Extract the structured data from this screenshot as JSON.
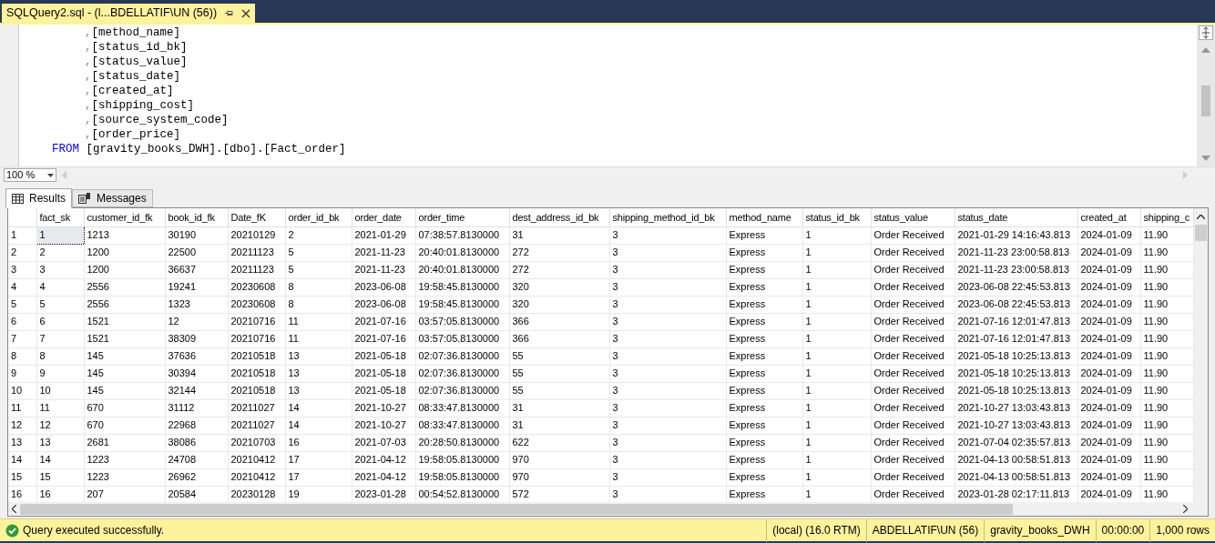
{
  "document_tab": {
    "title": "SQLQuery2.sql - (l...BDELLATIF\\UN (56))"
  },
  "editor": {
    "lines": [
      {
        "kind": "column",
        "prefix": ",",
        "text": "[method_name]"
      },
      {
        "kind": "column",
        "prefix": ",",
        "text": "[status_id_bk]"
      },
      {
        "kind": "column",
        "prefix": ",",
        "text": "[status_value]"
      },
      {
        "kind": "column",
        "prefix": ",",
        "text": "[status_date]"
      },
      {
        "kind": "column",
        "prefix": ",",
        "text": "[created_at]"
      },
      {
        "kind": "column",
        "prefix": ",",
        "text": "[shipping_cost]"
      },
      {
        "kind": "column",
        "prefix": ",",
        "text": "[source_system_code]"
      },
      {
        "kind": "column",
        "prefix": ",",
        "text": "[order_price]"
      },
      {
        "kind": "from",
        "keyword": "FROM",
        "text": "[gravity_books_DWH].[dbo].[Fact_order]"
      }
    ]
  },
  "zoom": {
    "value": "100 %"
  },
  "result_tabs": [
    {
      "label": "Results",
      "selected": true
    },
    {
      "label": "Messages",
      "selected": false
    }
  ],
  "table": {
    "columns": [
      "fact_sk",
      "customer_id_fk",
      "book_id_fk",
      "Date_fK",
      "order_id_bk",
      "order_date",
      "order_time",
      "dest_address_id_bk",
      "shipping_method_id_bk",
      "method_name",
      "status_id_bk",
      "status_value",
      "status_date",
      "created_at",
      "shipping_c"
    ],
    "rows": [
      {
        "number": "1",
        "focused": true,
        "cells": [
          "1",
          "1213",
          "30190",
          "20210129",
          "2",
          "2021-01-29",
          "07:38:57.8130000",
          "31",
          "3",
          "Express",
          "1",
          "Order Received",
          "2021-01-29 14:16:43.813",
          "2024-01-09",
          "11.90"
        ]
      },
      {
        "number": "2",
        "focused": false,
        "cells": [
          "2",
          "1200",
          "22500",
          "20211123",
          "5",
          "2021-11-23",
          "20:40:01.8130000",
          "272",
          "3",
          "Express",
          "1",
          "Order Received",
          "2021-11-23 23:00:58.813",
          "2024-01-09",
          "11.90"
        ]
      },
      {
        "number": "3",
        "focused": false,
        "cells": [
          "3",
          "1200",
          "36637",
          "20211123",
          "5",
          "2021-11-23",
          "20:40:01.8130000",
          "272",
          "3",
          "Express",
          "1",
          "Order Received",
          "2021-11-23 23:00:58.813",
          "2024-01-09",
          "11.90"
        ]
      },
      {
        "number": "4",
        "focused": false,
        "cells": [
          "4",
          "2556",
          "19241",
          "20230608",
          "8",
          "2023-06-08",
          "19:58:45.8130000",
          "320",
          "3",
          "Express",
          "1",
          "Order Received",
          "2023-06-08 22:45:53.813",
          "2024-01-09",
          "11.90"
        ]
      },
      {
        "number": "5",
        "focused": false,
        "cells": [
          "5",
          "2556",
          "1323",
          "20230608",
          "8",
          "2023-06-08",
          "19:58:45.8130000",
          "320",
          "3",
          "Express",
          "1",
          "Order Received",
          "2023-06-08 22:45:53.813",
          "2024-01-09",
          "11.90"
        ]
      },
      {
        "number": "6",
        "focused": false,
        "cells": [
          "6",
          "1521",
          "12",
          "20210716",
          "11",
          "2021-07-16",
          "03:57:05.8130000",
          "366",
          "3",
          "Express",
          "1",
          "Order Received",
          "2021-07-16 12:01:47.813",
          "2024-01-09",
          "11.90"
        ]
      },
      {
        "number": "7",
        "focused": false,
        "cells": [
          "7",
          "1521",
          "38309",
          "20210716",
          "11",
          "2021-07-16",
          "03:57:05.8130000",
          "366",
          "3",
          "Express",
          "1",
          "Order Received",
          "2021-07-16 12:01:47.813",
          "2024-01-09",
          "11.90"
        ]
      },
      {
        "number": "8",
        "focused": false,
        "cells": [
          "8",
          "145",
          "37636",
          "20210518",
          "13",
          "2021-05-18",
          "02:07:36.8130000",
          "55",
          "3",
          "Express",
          "1",
          "Order Received",
          "2021-05-18 10:25:13.813",
          "2024-01-09",
          "11.90"
        ]
      },
      {
        "number": "9",
        "focused": false,
        "cells": [
          "9",
          "145",
          "30394",
          "20210518",
          "13",
          "2021-05-18",
          "02:07:36.8130000",
          "55",
          "3",
          "Express",
          "1",
          "Order Received",
          "2021-05-18 10:25:13.813",
          "2024-01-09",
          "11.90"
        ]
      },
      {
        "number": "10",
        "focused": false,
        "cells": [
          "10",
          "145",
          "32144",
          "20210518",
          "13",
          "2021-05-18",
          "02:07:36.8130000",
          "55",
          "3",
          "Express",
          "1",
          "Order Received",
          "2021-05-18 10:25:13.813",
          "2024-01-09",
          "11.90"
        ]
      },
      {
        "number": "11",
        "focused": false,
        "cells": [
          "11",
          "670",
          "31112",
          "20211027",
          "14",
          "2021-10-27",
          "08:33:47.8130000",
          "31",
          "3",
          "Express",
          "1",
          "Order Received",
          "2021-10-27 13:03:43.813",
          "2024-01-09",
          "11.90"
        ]
      },
      {
        "number": "12",
        "focused": false,
        "cells": [
          "12",
          "670",
          "22968",
          "20211027",
          "14",
          "2021-10-27",
          "08:33:47.8130000",
          "31",
          "3",
          "Express",
          "1",
          "Order Received",
          "2021-10-27 13:03:43.813",
          "2024-01-09",
          "11.90"
        ]
      },
      {
        "number": "13",
        "focused": false,
        "cells": [
          "13",
          "2681",
          "38086",
          "20210703",
          "16",
          "2021-07-03",
          "20:28:50.8130000",
          "622",
          "3",
          "Express",
          "1",
          "Order Received",
          "2021-07-04 02:35:57.813",
          "2024-01-09",
          "11.90"
        ]
      },
      {
        "number": "14",
        "focused": false,
        "cells": [
          "14",
          "1223",
          "24708",
          "20210412",
          "17",
          "2021-04-12",
          "19:58:05.8130000",
          "970",
          "3",
          "Express",
          "1",
          "Order Received",
          "2021-04-13 00:58:51.813",
          "2024-01-09",
          "11.90"
        ]
      },
      {
        "number": "15",
        "focused": false,
        "cells": [
          "15",
          "1223",
          "26962",
          "20210412",
          "17",
          "2021-04-12",
          "19:58:05.8130000",
          "970",
          "3",
          "Express",
          "1",
          "Order Received",
          "2021-04-13 00:58:51.813",
          "2024-01-09",
          "11.90"
        ]
      },
      {
        "number": "16",
        "focused": false,
        "cells": [
          "16",
          "207",
          "20584",
          "20230128",
          "19",
          "2023-01-28",
          "00:54:52.8130000",
          "572",
          "3",
          "Express",
          "1",
          "Order Received",
          "2023-01-28 02:17:11.813",
          "2024-01-09",
          "11.90"
        ]
      }
    ]
  },
  "status_bar": {
    "message": "Query executed successfully.",
    "sections": [
      "(local) (16.0 RTM)",
      "ABDELLATIF\\UN (56)",
      "gravity_books_DWH",
      "00:00:00",
      "1,000 rows"
    ]
  }
}
